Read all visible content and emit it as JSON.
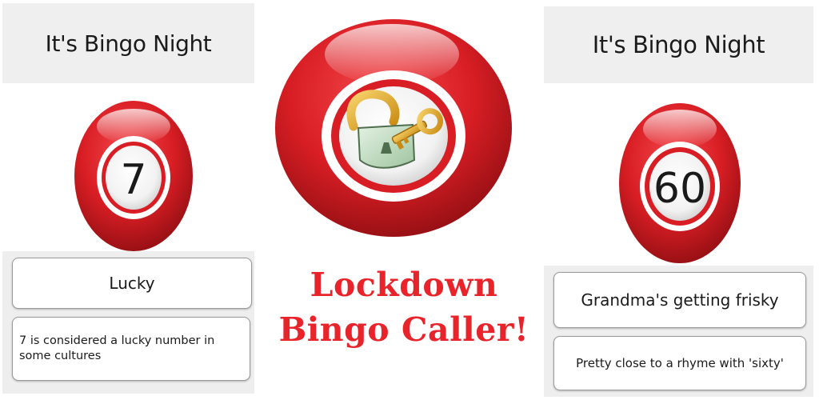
{
  "left_screen": {
    "header_title": "It's Bingo Night",
    "ball_number": "7",
    "call_name": "Lucky",
    "call_description": "7 is considered a lucky number in some cultures"
  },
  "promo": {
    "title_line1": "Lockdown",
    "title_line2": "Bingo Caller!",
    "icon": "padlock-with-key-icon",
    "accent_color": "#e8232a"
  },
  "right_screen": {
    "header_title": "It's Bingo Night",
    "ball_number": "60",
    "call_name": "Grandma's getting frisky",
    "call_description": "Pretty close to a rhyme with 'sixty'"
  },
  "colors": {
    "ball_red": "#d81e24",
    "header_gray": "#efefef"
  }
}
